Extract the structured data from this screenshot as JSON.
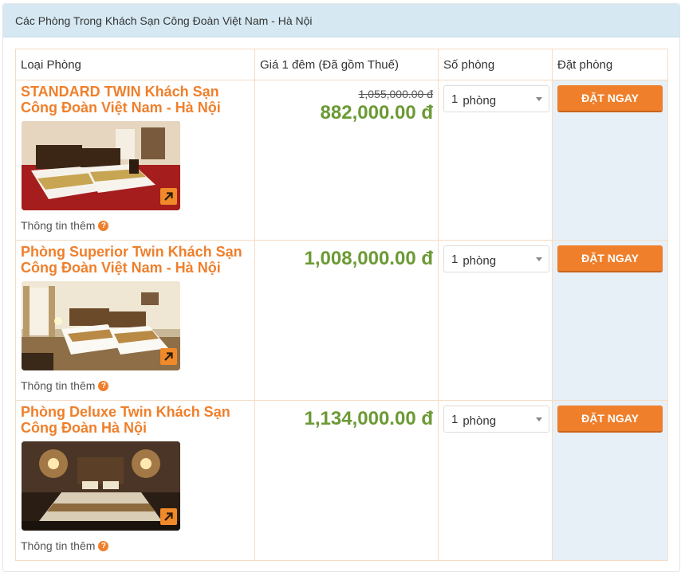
{
  "panel": {
    "title": "Các Phòng Trong Khách Sạn Công Đoàn Việt Nam - Hà Nội"
  },
  "table": {
    "headers": {
      "room_type": "Loại Phòng",
      "price": "Giá 1 đêm (Đã gồm Thuế)",
      "quantity": "Số phòng",
      "booking": "Đặt phòng"
    },
    "rows": [
      {
        "title": "STANDARD TWIN Khách Sạn Công Đoàn Việt Nam - Hà Nội",
        "more_info": "Thông tin thêm",
        "old_price": "1,055,000.00 đ",
        "price": "882,000.00 đ",
        "qty_number": "1",
        "qty_unit": "phòng",
        "book_label": "ĐẶT NGAY",
        "photo_scene": "red-carpet-twin-room"
      },
      {
        "title": "Phòng Superior Twin Khách Sạn Công Đoàn Việt Nam - Hà Nội",
        "more_info": "Thông tin thêm",
        "old_price": "",
        "price": "1,008,000.00 đ",
        "qty_number": "1",
        "qty_unit": "phòng",
        "book_label": "ĐẶT NGAY",
        "photo_scene": "bright-twin-room"
      },
      {
        "title": "Phòng Deluxe Twin Khách Sạn Công Đoàn Hà Nội",
        "more_info": "Thông tin thêm",
        "old_price": "",
        "price": "1,134,000.00 đ",
        "qty_number": "1",
        "qty_unit": "phòng",
        "book_label": "ĐẶT NGAY",
        "photo_scene": "dim-deluxe-room"
      }
    ]
  },
  "colors": {
    "accent": "#ef7f2b",
    "price_green": "#6b9a34",
    "header_bg": "#d6e9f3",
    "book_column_bg": "#e8f0f7"
  },
  "icons": {
    "photo_expand": "arrow-up-right-icon",
    "help": "question-circle-icon",
    "select_caret": "caret-down-icon"
  }
}
